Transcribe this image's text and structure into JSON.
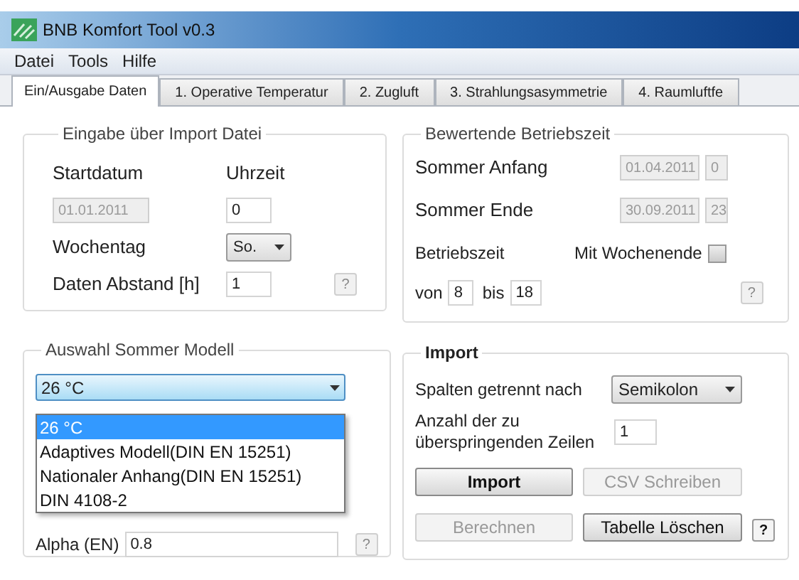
{
  "window": {
    "title": "BNB Komfort Tool v0.3"
  },
  "menu": [
    "Datei",
    "Tools",
    "Hilfe"
  ],
  "tabs": [
    {
      "label": "Ein/Ausgabe Daten",
      "selected": true
    },
    {
      "label": "1. Operative Temperatur",
      "selected": false
    },
    {
      "label": "2. Zugluft",
      "selected": false
    },
    {
      "label": "3. Strahlungsasymmetrie",
      "selected": false
    },
    {
      "label": "4. Raumluftfe",
      "selected": false
    }
  ],
  "import_file": {
    "title": "Eingabe über Import Datei",
    "start_date_label": "Startdatum",
    "time_label": "Uhrzeit",
    "start_date": {
      "value": "01.01.2011",
      "disabled": true
    },
    "start_time": {
      "value": "0",
      "disabled": false
    },
    "weekday_label": "Wochentag",
    "weekday": "So.",
    "interval_label": "Daten Abstand [h]",
    "interval": "1",
    "help": {
      "label": "?",
      "disabled": true
    }
  },
  "operating_time": {
    "title": "Bewertende Betriebszeit",
    "rows": [
      {
        "label": "Sommer Anfang",
        "date": "01.04.2011",
        "hour": "0",
        "disabled": true
      },
      {
        "label": "Sommer Ende",
        "date": "30.09.2011",
        "hour": "23",
        "disabled": true
      }
    ],
    "hours_label": "Betriebszeit",
    "weekend_label": "Mit Wochenende",
    "weekend_checked": false,
    "from_label": "von",
    "from": "8",
    "to_label": "bis",
    "to": "18",
    "help": {
      "label": "?",
      "disabled": true
    }
  },
  "summer_model": {
    "title": "Auswahl Sommer Modell",
    "value": "26 °C",
    "expanded": true,
    "options": [
      {
        "label": "26 °C",
        "selected": true
      },
      {
        "label": "Adaptives Modell(DIN EN 15251)",
        "selected": false
      },
      {
        "label": "Nationaler Anhang(DIN EN 15251)",
        "selected": false
      },
      {
        "label": "DIN 4108-2",
        "selected": false
      }
    ],
    "alpha_label": "Alpha (EN)",
    "alpha": "0.8",
    "help": {
      "label": "?",
      "disabled": true
    }
  },
  "import": {
    "title": "Import",
    "separator_label": "Spalten getrennt nach",
    "separator": "Semikolon",
    "skip_label_1": "Anzahl der zu",
    "skip_label_2": "überspringenden Zeilen",
    "skip": "1",
    "buttons": [
      {
        "label": "Import",
        "disabled": false
      },
      {
        "label": "CSV Schreiben",
        "disabled": true
      },
      {
        "label": "Berechnen",
        "disabled": true
      },
      {
        "label": "Tabelle Löschen",
        "disabled": false
      }
    ],
    "help": {
      "label": "?",
      "disabled": false
    }
  }
}
